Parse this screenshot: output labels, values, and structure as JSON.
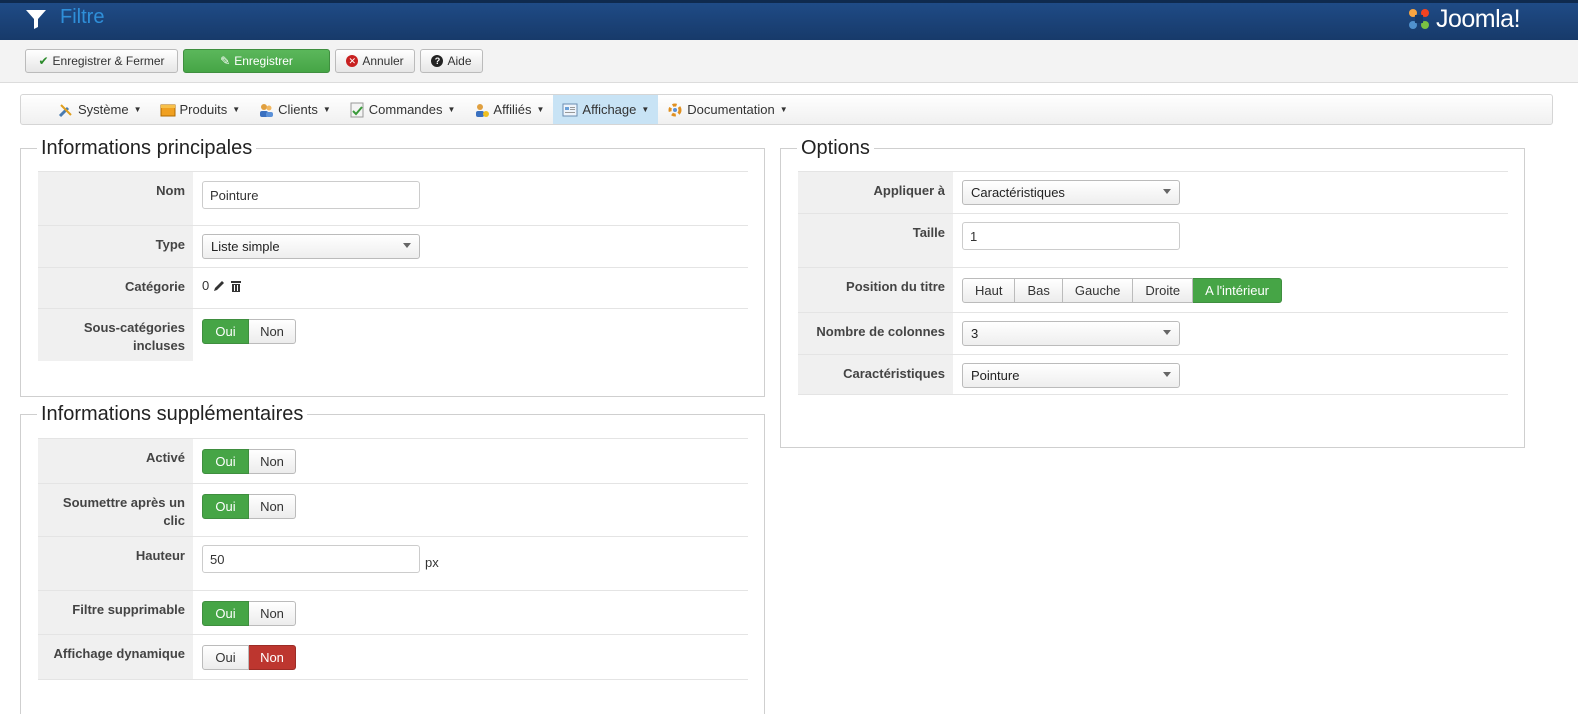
{
  "header": {
    "title": "Filtre",
    "brand": "Joomla!"
  },
  "toolbar": {
    "save_close": "Enregistrer & Fermer",
    "save": "Enregistrer",
    "cancel": "Annuler",
    "help": "Aide"
  },
  "menu": {
    "items": [
      {
        "label": "Système",
        "icon": "tools-icon"
      },
      {
        "label": "Produits",
        "icon": "box-icon"
      },
      {
        "label": "Clients",
        "icon": "users-icon"
      },
      {
        "label": "Commandes",
        "icon": "orders-icon"
      },
      {
        "label": "Affiliés",
        "icon": "affiliates-icon"
      },
      {
        "label": "Affichage",
        "icon": "display-icon",
        "active": true
      },
      {
        "label": "Documentation",
        "icon": "documentation-icon"
      }
    ]
  },
  "main_info": {
    "legend": "Informations principales",
    "name_label": "Nom",
    "name_value": "Pointure",
    "type_label": "Type",
    "type_value": "Liste simple",
    "category_label": "Catégorie",
    "category_value": "0",
    "subcat_label": "Sous-catégories incluses"
  },
  "extra_info": {
    "legend": "Informations supplémentaires",
    "active_label": "Activé",
    "submit_label": "Soumettre après un clic",
    "height_label": "Hauteur",
    "height_value": "50",
    "height_unit": "px",
    "removable_label": "Filtre supprimable",
    "dynamic_label": "Affichage dynamique"
  },
  "toggle": {
    "yes": "Oui",
    "no": "Non"
  },
  "options": {
    "legend": "Options",
    "apply_label": "Appliquer à",
    "apply_value": "Caractéristiques",
    "size_label": "Taille",
    "size_value": "1",
    "title_pos_label": "Position du titre",
    "title_positions": [
      "Haut",
      "Bas",
      "Gauche",
      "Droite",
      "A l'intérieur"
    ],
    "columns_label": "Nombre de colonnes",
    "columns_value": "3",
    "characteristics_label": "Caractéristiques",
    "characteristics_value": "Pointure"
  },
  "colors": {
    "header_bg": "#1f4b86",
    "success": "#46a546",
    "danger": "#bd362f",
    "active_menu": "#c8e3f5"
  }
}
